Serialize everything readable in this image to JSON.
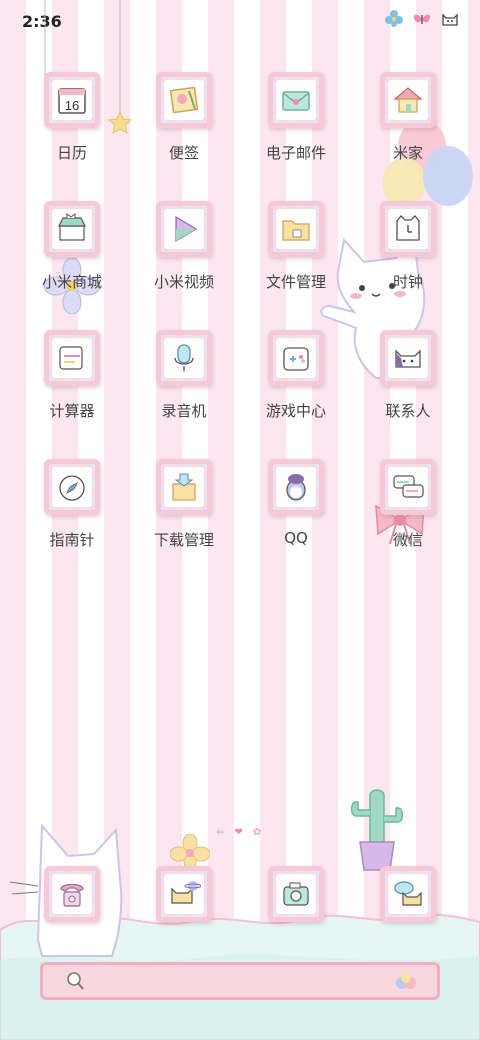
{
  "status_bar": {
    "time": "2:36"
  },
  "apps": [
    {
      "label": "日历",
      "icon": "calendar-icon",
      "value": "16"
    },
    {
      "label": "便签",
      "icon": "notes-icon"
    },
    {
      "label": "电子邮件",
      "icon": "mail-icon"
    },
    {
      "label": "米家",
      "icon": "house-icon"
    },
    {
      "label": "小米商城",
      "icon": "store-icon"
    },
    {
      "label": "小米视频",
      "icon": "video-play-icon"
    },
    {
      "label": "文件管理",
      "icon": "folder-icon"
    },
    {
      "label": "时钟",
      "icon": "clock-icon"
    },
    {
      "label": "计算器",
      "icon": "calculator-icon"
    },
    {
      "label": "录音机",
      "icon": "microphone-icon"
    },
    {
      "label": "游戏中心",
      "icon": "gamepad-icon"
    },
    {
      "label": "联系人",
      "icon": "contacts-cat-icon"
    },
    {
      "label": "指南针",
      "icon": "compass-icon"
    },
    {
      "label": "下载管理",
      "icon": "download-icon"
    },
    {
      "label": "QQ",
      "icon": "qq-penguin-icon"
    },
    {
      "label": "微信",
      "icon": "wechat-chat-icon"
    }
  ],
  "dock": [
    {
      "icon": "phone-icon"
    },
    {
      "icon": "browser-planet-cat-icon"
    },
    {
      "icon": "camera-icon"
    },
    {
      "icon": "messages-cat-icon"
    }
  ],
  "colors": {
    "accent_pink": "#f6c9d8",
    "stripe_pink": "#fce6ef",
    "search_bar": "#fad6df"
  }
}
